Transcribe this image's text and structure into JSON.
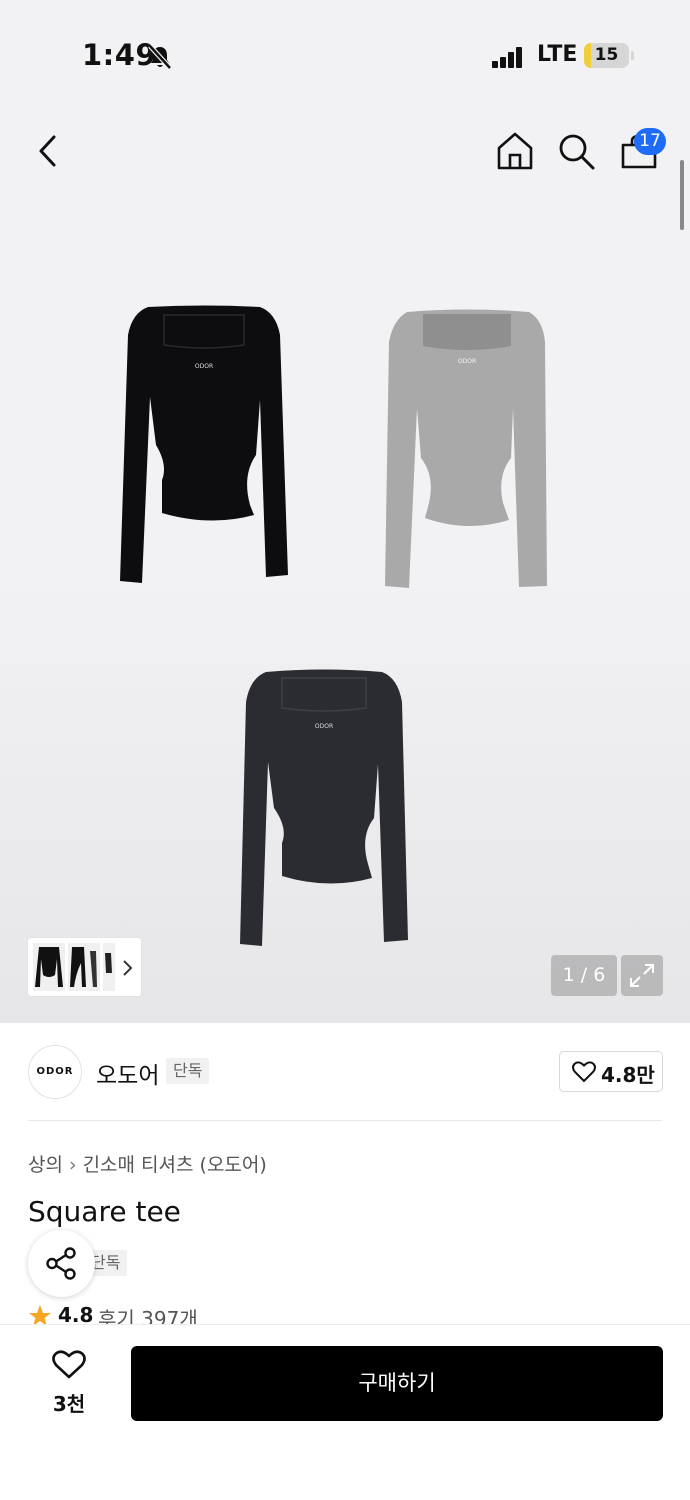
{
  "status_bar": {
    "time": "1:49",
    "network": "LTE",
    "battery": "15"
  },
  "nav": {
    "cart_count": "17"
  },
  "gallery": {
    "counter": "1 / 6",
    "garment_logo": "ODOR"
  },
  "brand": {
    "logo_text": "ODOR",
    "name": "오도어",
    "badge": "단독",
    "likes": "4.8만"
  },
  "breadcrumb": {
    "category": "상의",
    "subcategory": "긴소매 티셔츠 (오도어)"
  },
  "product": {
    "title": "Square tee",
    "badge": "단독",
    "rating": "4.8",
    "reviews": "후기 397개"
  },
  "bottom_bar": {
    "wish_count": "3천",
    "buy_label": "구매하기"
  },
  "colors": {
    "accent_badge": "#1e6bf5",
    "star": "#f5a623",
    "garment_black": "#0d0d0f",
    "garment_grey": "#a9a9a9",
    "garment_charcoal": "#2b2c31"
  }
}
